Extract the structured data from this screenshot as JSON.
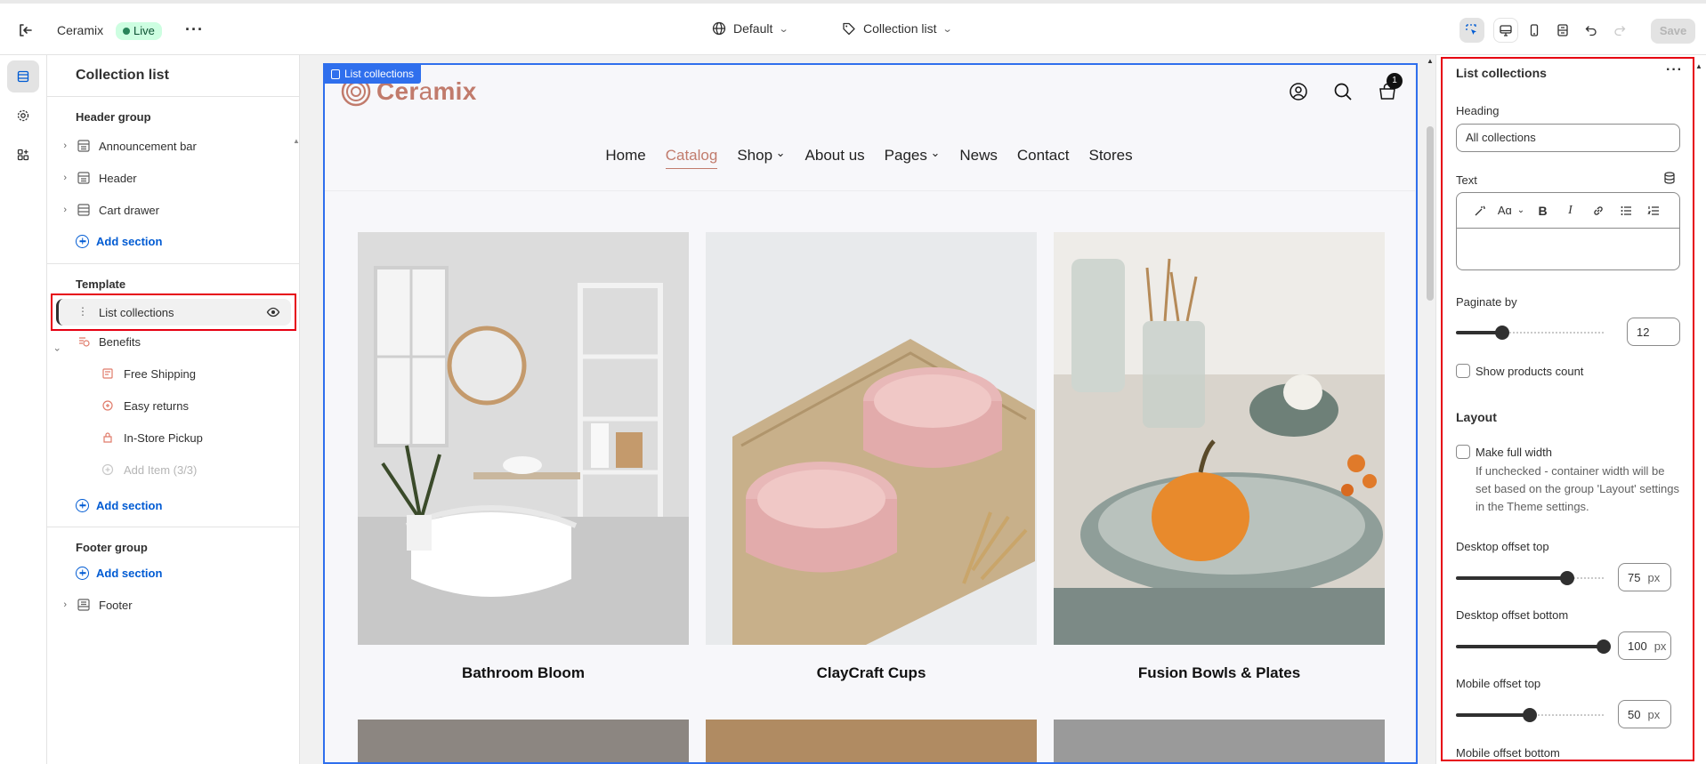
{
  "topbar": {
    "store_name": "Ceramix",
    "status": "Live",
    "theme_selector": "Default",
    "template_selector": "Collection list",
    "save_label": "Save"
  },
  "sidebar": {
    "title": "Collection list",
    "header_group": {
      "title": "Header group",
      "sections": [
        "Announcement bar",
        "Header",
        "Cart drawer"
      ],
      "add_label": "Add section"
    },
    "template_group": {
      "title": "Template",
      "sections": [
        {
          "label": "List collections",
          "selected": true
        },
        {
          "label": "Benefits",
          "expanded": true
        }
      ],
      "blocks": [
        "Free Shipping",
        "Easy returns",
        "In-Store Pickup"
      ],
      "add_item_label": "Add Item (3/3)",
      "add_label": "Add section"
    },
    "footer_group": {
      "title": "Footer group",
      "add_label": "Add section",
      "sections": [
        "Footer"
      ]
    }
  },
  "preview": {
    "selection_tag": "List collections",
    "logo": {
      "bold": "Cer",
      "light": "a",
      "rest": "mix"
    },
    "cart_count": "1",
    "nav": [
      "Home",
      "Catalog",
      "Shop",
      "About us",
      "Pages",
      "News",
      "Contact",
      "Stores"
    ],
    "active_nav": "Catalog",
    "collections": [
      "Bathroom Bloom",
      "ClayCraft Cups",
      "Fusion Bowls & Plates"
    ]
  },
  "settings": {
    "title": "List collections",
    "heading_label": "Heading",
    "heading_value": "All collections",
    "text_label": "Text",
    "paginate_label": "Paginate by",
    "paginate_value": "12",
    "paginate_fraction": 0.3,
    "show_count_label": "Show products count",
    "layout_heading": "Layout",
    "full_width_label": "Make full width",
    "full_width_help": "If unchecked - container width will be set based on the group 'Layout' settings in the Theme settings.",
    "desktop_top_label": "Desktop offset top",
    "desktop_top_value": "75",
    "desktop_top_fraction": 0.75,
    "desktop_bottom_label": "Desktop offset bottom",
    "desktop_bottom_value": "100",
    "desktop_bottom_fraction": 1.0,
    "mobile_top_label": "Mobile offset top",
    "mobile_top_value": "50",
    "mobile_top_fraction": 0.5,
    "mobile_bottom_label": "Mobile offset bottom",
    "unit": "px"
  }
}
